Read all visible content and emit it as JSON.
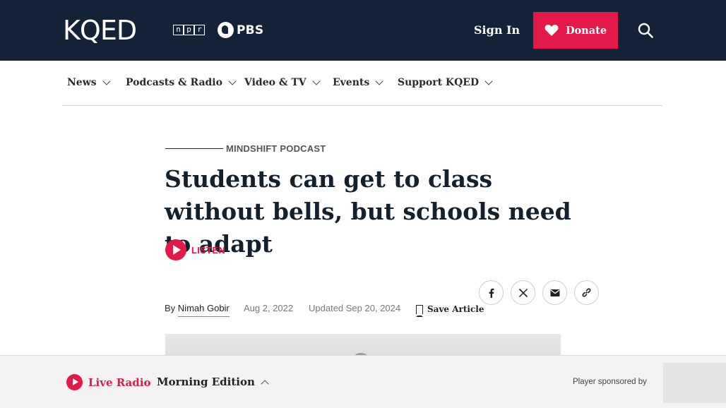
{
  "header": {
    "logo_text": "KQED",
    "npr_letters": [
      "n",
      "p",
      "r"
    ],
    "pbs_text": "PBS",
    "signin_label": "Sign In",
    "donate_label": "Donate",
    "brand_color": "#e3194a",
    "bg_color": "#132236"
  },
  "nav": {
    "items": [
      {
        "label": "News"
      },
      {
        "label": "Podcasts & Radio"
      },
      {
        "label": "Video & TV"
      },
      {
        "label": "Events"
      },
      {
        "label": "Support KQED"
      }
    ]
  },
  "article": {
    "kicker": "MINDSHIFT PODCAST",
    "headline": "Students can get to class without bells, but schools need to adapt",
    "listen_label": "LISTEN",
    "byline_prefix": "By",
    "author": "Nimah Gobir",
    "date": "Aug 2, 2022",
    "updated": "Updated Sep 20, 2024",
    "save_label": "Save Article",
    "share_icons": [
      "facebook-icon",
      "x-icon",
      "email-icon",
      "link-icon"
    ]
  },
  "player": {
    "live_label": "Live Radio",
    "program": "Morning Edition",
    "sponsored": "Player sponsored by"
  }
}
